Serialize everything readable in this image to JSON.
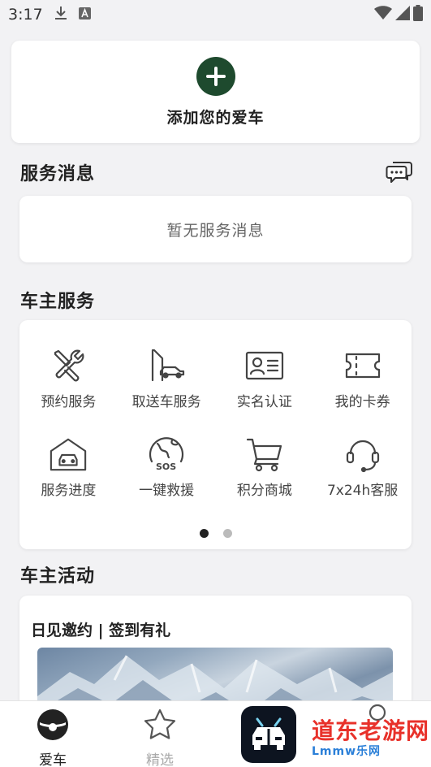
{
  "status_bar": {
    "time": "3:17",
    "icons": [
      "download-icon",
      "a-badge-icon",
      "wifi-icon",
      "signal-icon",
      "battery-icon"
    ]
  },
  "add_car": {
    "label": "添加您的爱车",
    "accent_color": "#1e4a2e"
  },
  "service_messages": {
    "title": "服务消息",
    "empty_text": "暂无服务消息",
    "icon": "chat-bubbles-icon"
  },
  "owner_services": {
    "title": "车主服务",
    "items": [
      {
        "label": "预约服务",
        "icon": "tools-icon"
      },
      {
        "label": "取送车服务",
        "icon": "car-pickup-icon"
      },
      {
        "label": "实名认证",
        "icon": "id-card-icon"
      },
      {
        "label": "我的卡券",
        "icon": "ticket-icon"
      },
      {
        "label": "服务进度",
        "icon": "garage-icon"
      },
      {
        "label": "一键救援",
        "icon": "sos-globe-icon"
      },
      {
        "label": "积分商城",
        "icon": "cart-icon"
      },
      {
        "label": "7x24h客服",
        "icon": "headset-icon"
      }
    ],
    "pagination": {
      "pages": 2,
      "active": 1
    }
  },
  "owner_activities": {
    "title": "车主活动",
    "card_title": "日见邀约 | 签到有礼"
  },
  "tabbar": {
    "home_label": "爱车",
    "picks_label": "精选"
  },
  "watermark": {
    "main": "道东老游网",
    "sub": "Lmmw乐网"
  }
}
